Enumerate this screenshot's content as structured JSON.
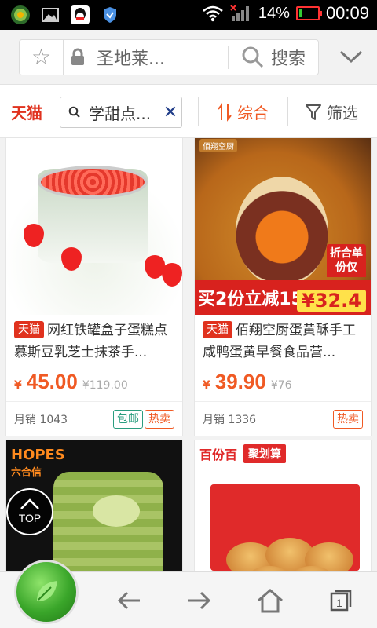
{
  "status_bar": {
    "battery_percent_label": "14%",
    "time": "00:09",
    "battery_level": 0.14
  },
  "url_bar": {
    "url_text": "圣地莱...",
    "search_label": "搜索"
  },
  "search_row": {
    "brand_label": "天猫",
    "query": "学甜点...",
    "sort_label": "综合",
    "filter_label": "筛选"
  },
  "products": [
    {
      "badge": "天猫",
      "title": "网红铁罐盒子蛋糕点慕斯豆乳芝士抹茶手...",
      "currency": "¥",
      "price": "45.00",
      "original_price": "¥119.00",
      "sales": "月销 1043",
      "tags": [
        "包邮",
        "热卖"
      ]
    },
    {
      "badge": "天猫",
      "title": "佰翔空厨蛋黄酥手工咸鸭蛋黄早餐食品营...",
      "currency": "¥",
      "price": "39.90",
      "original_price": "¥76",
      "sales": "月销 1336",
      "tags": [
        "热卖"
      ],
      "image_promo": "买2份立减15",
      "image_promo_amount": "¥32.4",
      "image_promo_side": "折合单份仅",
      "image_brand": "佰翔空厨"
    },
    {
      "image_brand": "HOPES",
      "image_brand_cn": "六合信"
    },
    {
      "image_brand": "百份百",
      "image_brand_tag": "聚划算"
    }
  ],
  "floating": {
    "top_button_label": "TOP"
  },
  "colors": {
    "accent": "#f05a24",
    "tmall_red": "#e0321e",
    "free_shipping_green": "#2a9d7f"
  }
}
